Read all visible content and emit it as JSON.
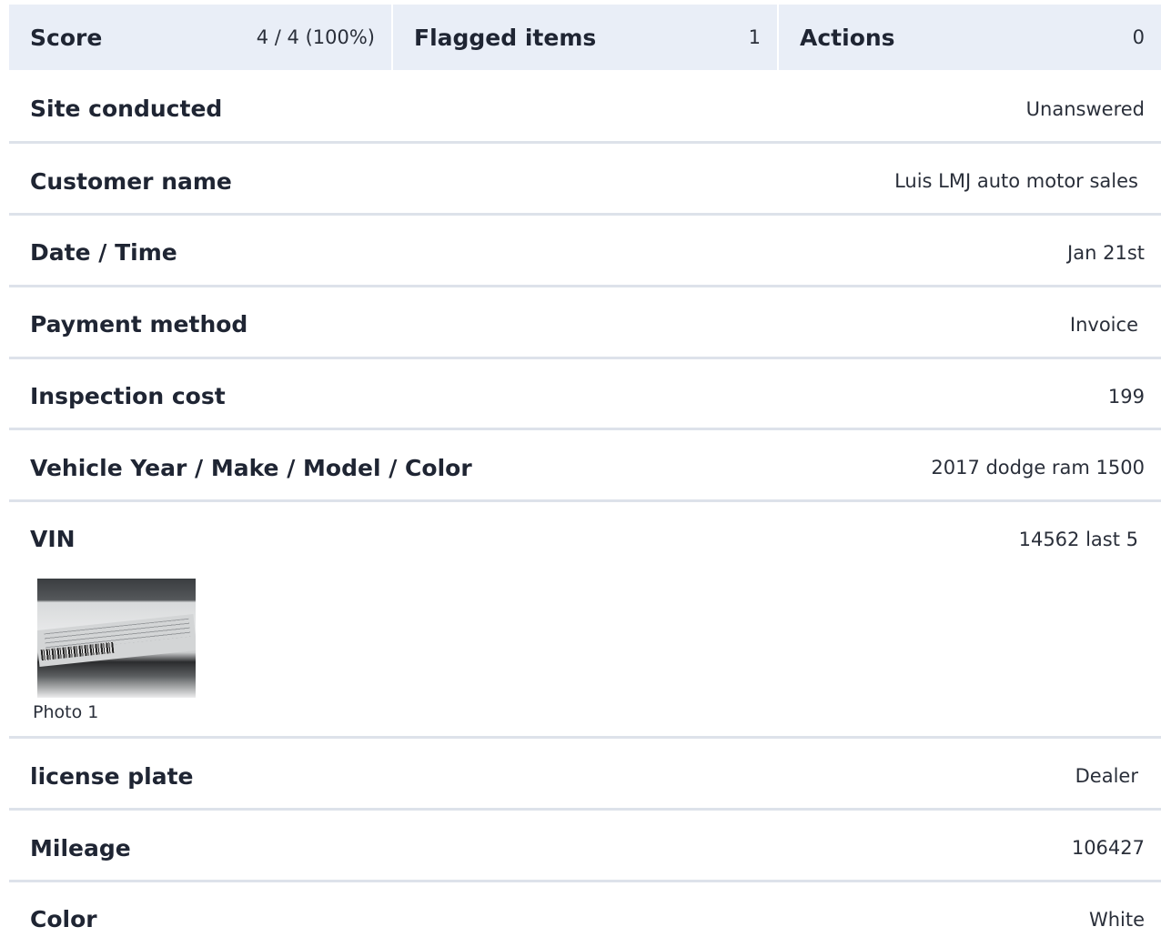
{
  "summary": {
    "score_label": "Score",
    "score_value": "4 / 4 (100%)",
    "flagged_label": "Flagged items",
    "flagged_value": "1",
    "actions_label": "Actions",
    "actions_value": "0"
  },
  "fields": [
    {
      "label": "Site conducted",
      "value": "Unanswered"
    },
    {
      "label": "Customer name",
      "value": "Luis LMJ auto motor sales"
    },
    {
      "label": "Date / Time",
      "value": "Jan 21st"
    },
    {
      "label": "Payment method",
      "value": "Invoice"
    },
    {
      "label": "Inspection cost",
      "value": "199"
    },
    {
      "label": "Vehicle Year / Make / Model / Color",
      "value": "2017 dodge ram 1500"
    },
    {
      "label": "VIN",
      "value": "14562 last 5",
      "photo_caption": "Photo 1"
    },
    {
      "label": "license plate",
      "value": "Dealer"
    },
    {
      "label": "Mileage",
      "value": "106427"
    },
    {
      "label": "Color",
      "value": "White"
    }
  ],
  "colors": {
    "summary_bg": "#e9eef7",
    "divider": "#dde2ea",
    "text": "#1f2533"
  }
}
